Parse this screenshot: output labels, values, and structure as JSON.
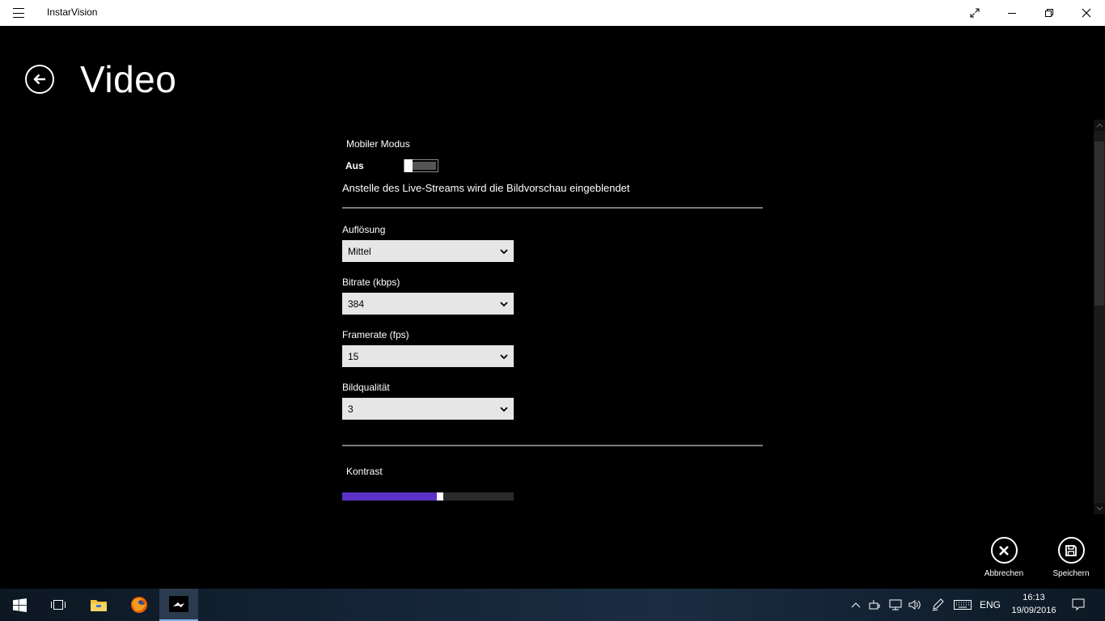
{
  "window": {
    "title": "InstarVision"
  },
  "page": {
    "title": "Video"
  },
  "mobile_mode": {
    "label": "Mobiler Modus",
    "state": "Aus",
    "on": false,
    "description": "Anstelle des Live-Streams wird die Bildvorschau eingeblendet"
  },
  "fields": {
    "resolution": {
      "label": "Auflösung",
      "value": "Mittel"
    },
    "bitrate": {
      "label": "Bitrate (kbps)",
      "value": "384"
    },
    "framerate": {
      "label": "Framerate (fps)",
      "value": "15"
    },
    "quality": {
      "label": "Bildqualität",
      "value": "3"
    }
  },
  "contrast": {
    "label": "Kontrast",
    "value_fraction": 0.57,
    "accent_color": "#5b32c5"
  },
  "commands": {
    "cancel": "Abbrechen",
    "save": "Speichern"
  },
  "taskbar": {
    "language": "ENG",
    "time": "16:13",
    "date": "19/09/2016"
  },
  "icons": [
    "hamburger-icon",
    "expand-icon",
    "minimize-icon",
    "restore-icon",
    "close-icon",
    "back-arrow-icon",
    "chevron-down-icon",
    "cancel-x-icon",
    "save-disk-icon",
    "windows-start-icon",
    "task-view-icon",
    "file-explorer-icon",
    "firefox-icon",
    "instarvision-app-icon",
    "chevron-up-icon",
    "network-icon",
    "volume-icon",
    "pen-icon",
    "keyboard-icon",
    "notification-icon"
  ]
}
